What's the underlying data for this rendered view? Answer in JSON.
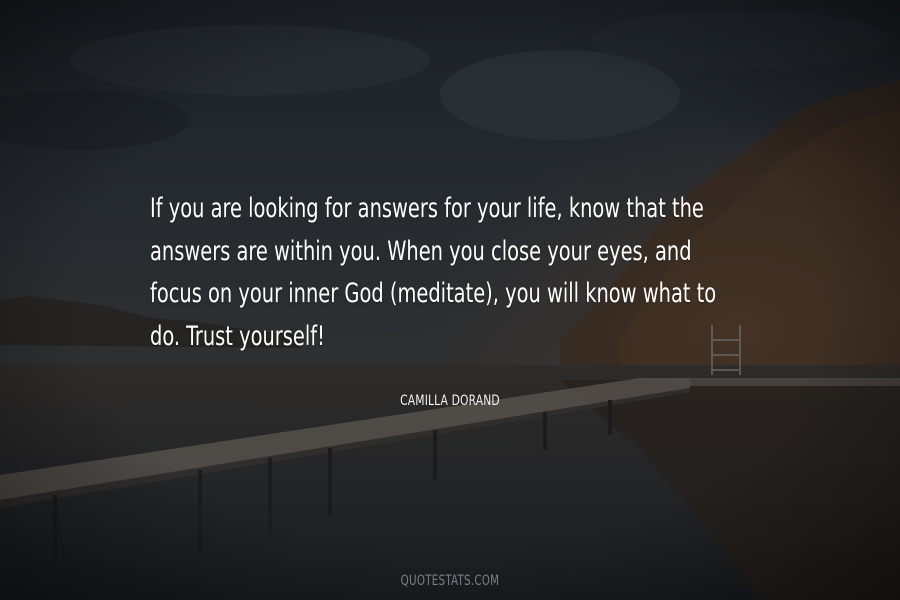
{
  "quote": {
    "lines": [
      "If you are looking for answers for your life, know that the",
      "answers are within you. When you close your eyes, and",
      "focus on your inner God (meditate), you will know what to",
      "do. Trust yourself!"
    ],
    "author": "CAMILLA DORAND"
  },
  "footer": {
    "source": "QUOTESTATS.COM"
  },
  "colors": {
    "text": "#ffffff",
    "author": "#f2f2f2",
    "source": "#7a7f86",
    "sky": "#2b3037",
    "water": "#2a2b2e"
  }
}
